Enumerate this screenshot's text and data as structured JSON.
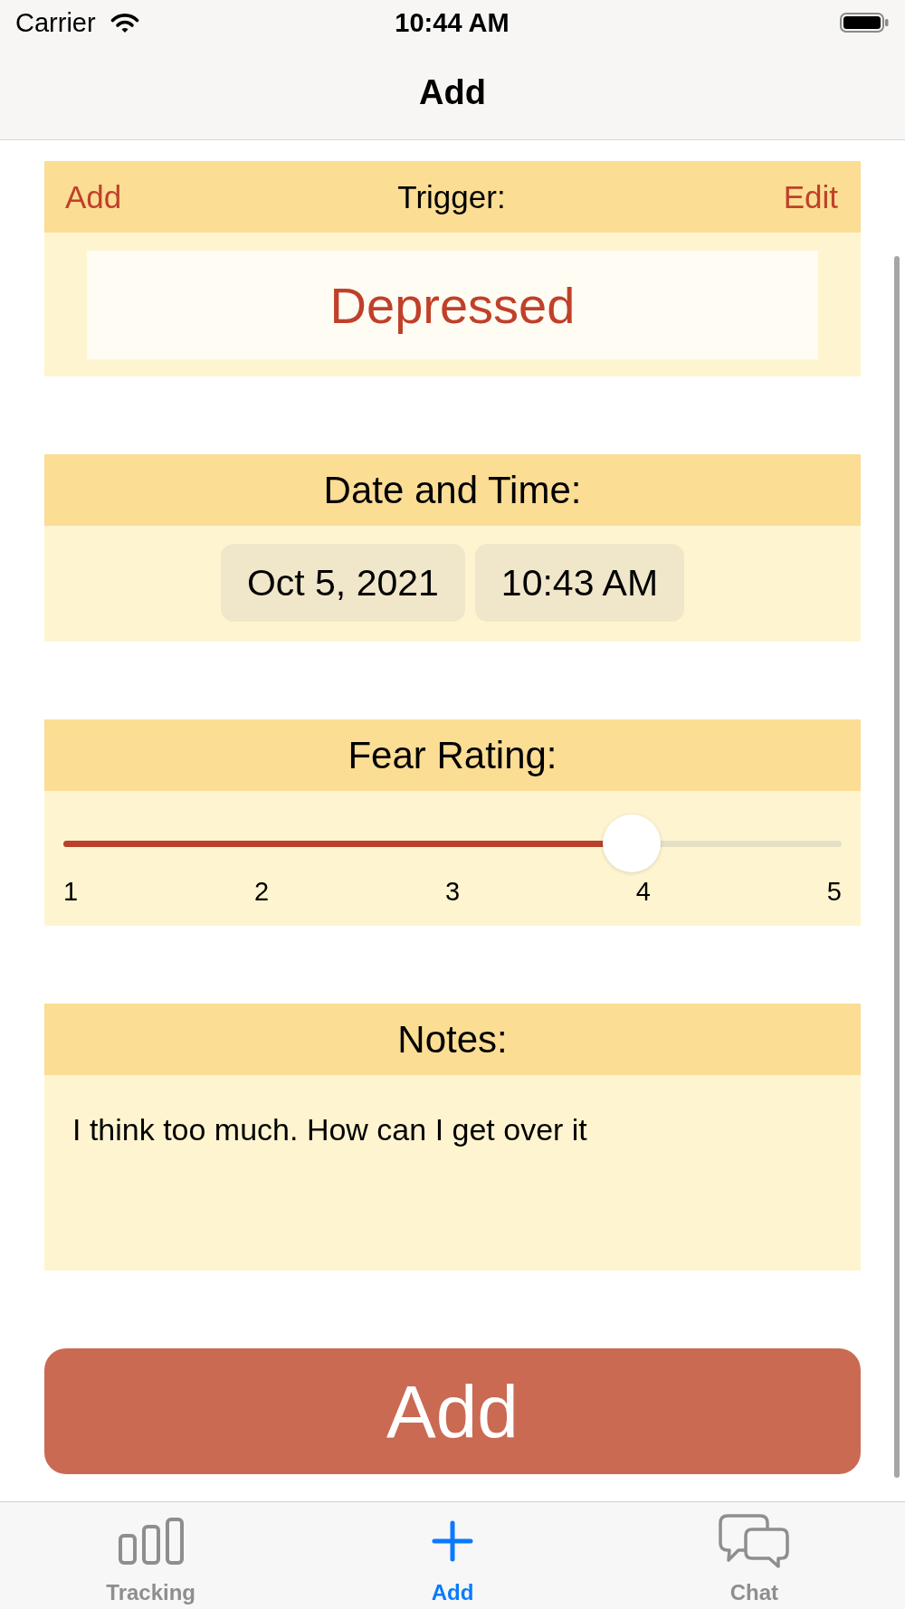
{
  "status_bar": {
    "carrier": "Carrier",
    "time": "10:44 AM"
  },
  "nav_bar": {
    "title": "Add"
  },
  "trigger_section": {
    "add_link": "Add",
    "title": "Trigger:",
    "edit_link": "Edit",
    "value": "Depressed"
  },
  "date_time_section": {
    "title": "Date and Time:",
    "date": "Oct 5, 2021",
    "time": "10:43 AM"
  },
  "fear_rating_section": {
    "title": "Fear Rating:",
    "slider": {
      "level": 0.73
    },
    "scale_labels": [
      "1",
      "2",
      "3",
      "4",
      "5"
    ]
  },
  "notes_section": {
    "title": "Notes:",
    "value": "I think too much. How can I get over it"
  },
  "add_button": {
    "label": "Add"
  },
  "tab_bar": {
    "tabs": [
      {
        "label": "Tracking",
        "selected": false
      },
      {
        "label": "Add",
        "selected": true
      },
      {
        "label": "Chat",
        "selected": false
      }
    ]
  }
}
